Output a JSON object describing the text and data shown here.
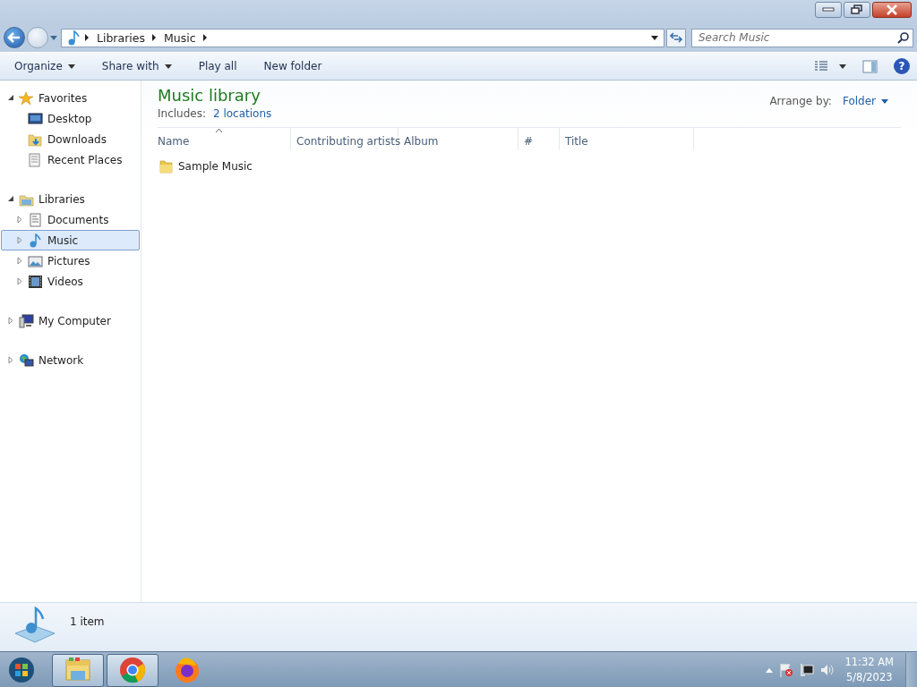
{
  "address": {
    "crumbs": [
      "Libraries",
      "Music"
    ]
  },
  "search": {
    "placeholder": "Search Music"
  },
  "toolbar": {
    "buttons": [
      {
        "label": "Organize",
        "menu": true
      },
      {
        "label": "Share with",
        "menu": true
      },
      {
        "label": "Play all",
        "menu": false
      },
      {
        "label": "New folder",
        "menu": false
      }
    ],
    "help_label": "?"
  },
  "sidebar": {
    "items": [
      {
        "label": "Favorites",
        "expanded": true,
        "selected": false,
        "children": [
          {
            "label": "Desktop",
            "selected": false
          },
          {
            "label": "Downloads",
            "selected": false
          },
          {
            "label": "Recent Places",
            "selected": false
          }
        ]
      },
      {
        "label": "Libraries",
        "expanded": true,
        "selected": false,
        "children": [
          {
            "label": "Documents",
            "expanded": false,
            "selected": false
          },
          {
            "label": "Music",
            "expanded": false,
            "selected": true
          },
          {
            "label": "Pictures",
            "expanded": false,
            "selected": false
          },
          {
            "label": "Videos",
            "expanded": false,
            "selected": false
          }
        ]
      },
      {
        "label": "My Computer",
        "expanded": false,
        "selected": false
      },
      {
        "label": "Network",
        "expanded": false,
        "selected": false
      }
    ]
  },
  "library": {
    "title": "Music library",
    "includes_label": "Includes:",
    "locations_link": "2 locations",
    "arrange_label": "Arrange by:",
    "arrange_value": "Folder"
  },
  "table": {
    "columns": [
      {
        "label": "Name",
        "sorted": true
      },
      {
        "label": "Contributing artists",
        "sorted": false
      },
      {
        "label": "Album",
        "sorted": false
      },
      {
        "label": "#",
        "sorted": false
      },
      {
        "label": "Title",
        "sorted": false
      }
    ],
    "rows": [
      {
        "name": "Sample Music",
        "kind": "folder"
      }
    ]
  },
  "status_bar": {
    "text": "1 item"
  },
  "taskbar": {
    "apps": [
      {
        "open": true
      },
      {
        "open": true
      },
      {
        "open": false
      }
    ],
    "time": "11:32 AM",
    "date": "5/8/2023"
  }
}
